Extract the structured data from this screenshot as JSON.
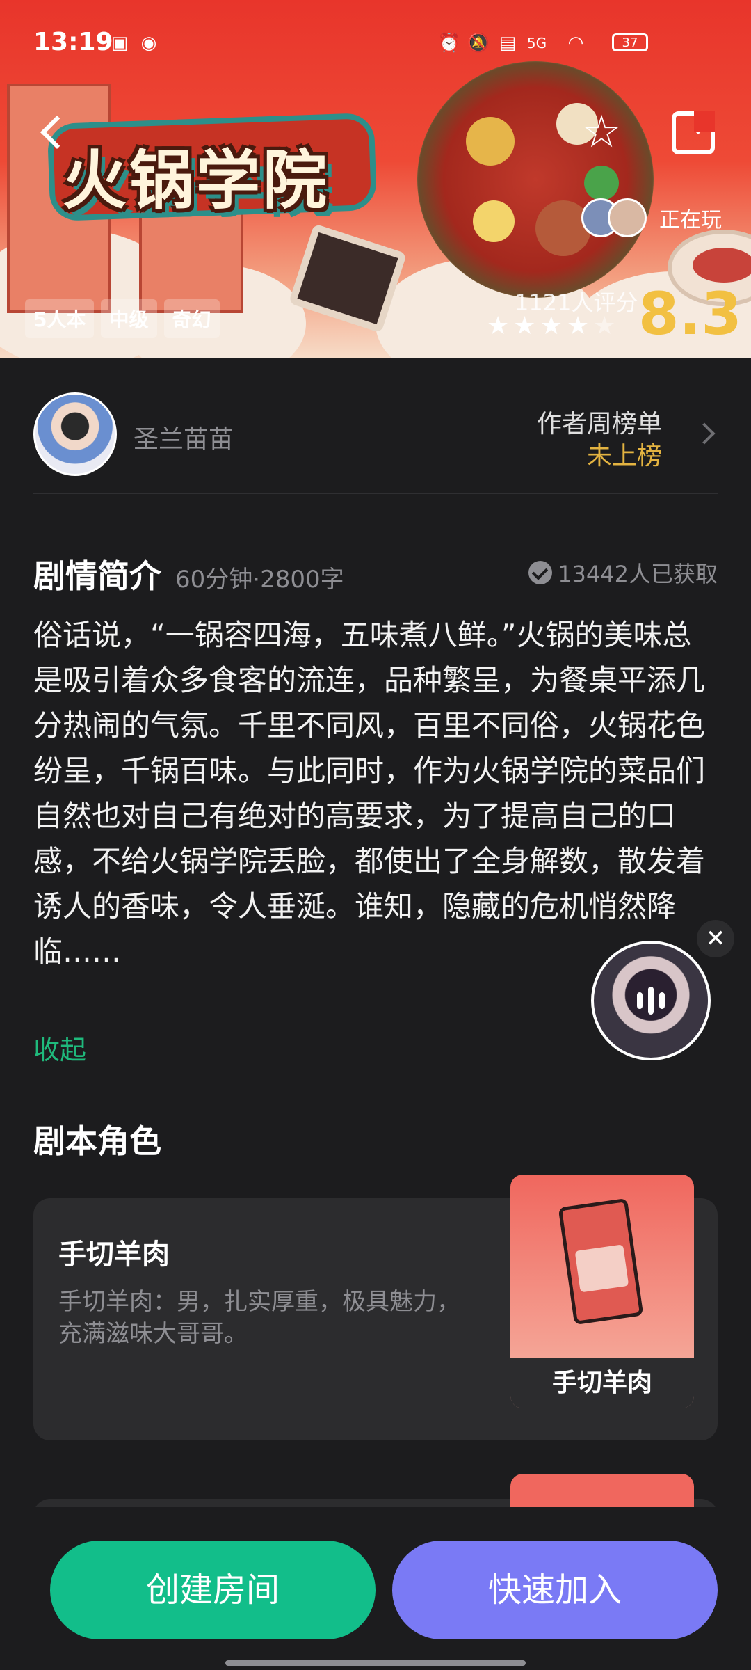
{
  "status_bar": {
    "time": "13:19",
    "network": "5G",
    "battery": "37"
  },
  "header": {
    "title_art": "火锅学院",
    "playing_label": "正在玩",
    "tags": [
      "5人本",
      "中级",
      "奇幻"
    ],
    "rating_count": "1121人评分",
    "score": "8.3",
    "stars_filled": 4,
    "stars_total": 5,
    "colors": {
      "banner": "#e8352b",
      "score": "#f2c042"
    }
  },
  "author": {
    "name": "圣兰苗苗",
    "rank_label": "作者周榜单",
    "rank_value": "未上榜"
  },
  "synopsis": {
    "title": "剧情简介",
    "meta": "60分钟·2800字",
    "obtained": "13442人已获取",
    "body": "俗话说，“一锅容四海，五味煮八鲜。”火锅的美味总是吸引着众多食客的流连，品种繁呈，为餐桌平添几分热闹的气氛。千里不同风，百里不同俗，火锅花色纷呈，千锅百味。与此同时，作为火锅学院的菜品们自然也对自己有绝对的高要求，为了提高自己的口感，不给火锅学院丢脸，都使出了全身解数，散发着诱人的香味，令人垂涎。谁知，隐藏的危机悄然降临……",
    "collapse_label": "收起"
  },
  "roles": {
    "title": "剧本角色",
    "items": [
      {
        "name": "手切羊肉",
        "description": "手切羊肉：男，扎实厚重，极具魅力，充满滋味大哥哥。",
        "portrait_label": "手切羊肉"
      }
    ]
  },
  "actions": {
    "create_room": "创建房间",
    "quick_join": "快速加入",
    "colors": {
      "create": "#12be8a",
      "join": "#7a7af5"
    }
  }
}
